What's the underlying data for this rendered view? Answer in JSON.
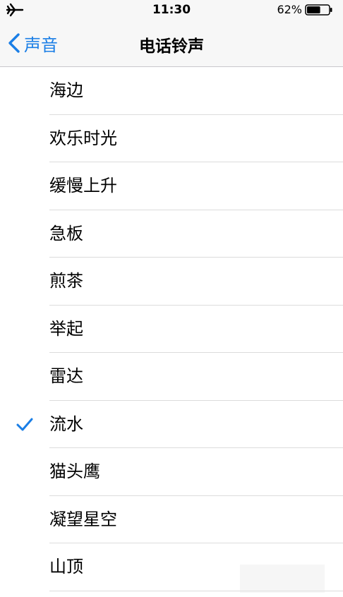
{
  "status_bar": {
    "time": "11:30",
    "battery_percent": "62%",
    "battery_level": 0.62,
    "airplane_icon": "airplane-icon",
    "battery_icon": "battery-icon"
  },
  "nav": {
    "back_label": "声音",
    "back_icon": "chevron-left-icon",
    "title": "电话铃声",
    "accent_color": "#1a7ee6"
  },
  "ringtones": {
    "items": [
      {
        "label": "海边",
        "selected": false
      },
      {
        "label": "欢乐时光",
        "selected": false
      },
      {
        "label": "缓慢上升",
        "selected": false
      },
      {
        "label": "急板",
        "selected": false
      },
      {
        "label": "煎茶",
        "selected": false
      },
      {
        "label": "举起",
        "selected": false
      },
      {
        "label": "雷达",
        "selected": false
      },
      {
        "label": "流水",
        "selected": true
      },
      {
        "label": "猫头鹰",
        "selected": false
      },
      {
        "label": "凝望星空",
        "selected": false
      },
      {
        "label": "山顶",
        "selected": false
      }
    ],
    "check_icon": "checkmark-icon"
  }
}
